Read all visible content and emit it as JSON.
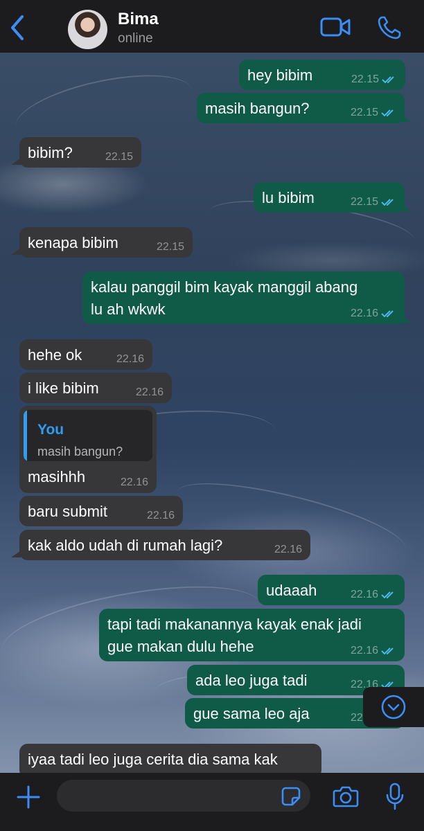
{
  "header": {
    "contact_name": "Bima",
    "status": "online"
  },
  "messages": [
    {
      "direction": "out",
      "text": "hey bibim",
      "time": "22.15",
      "read": true
    },
    {
      "direction": "out",
      "text": "masih bangun?",
      "time": "22.15",
      "read": true
    },
    {
      "direction": "in",
      "text": "bibim?",
      "time": "22.15"
    },
    {
      "direction": "out",
      "text": "lu bibim",
      "time": "22.15",
      "read": true
    },
    {
      "direction": "in",
      "text": "kenapa bibim",
      "time": "22.15"
    },
    {
      "direction": "out",
      "text_lines": [
        "kalau panggil bim kayak manggil abang",
        "lu ah wkwk"
      ],
      "time": "22.16",
      "read": true
    },
    {
      "direction": "in",
      "text": "hehe ok",
      "time": "22.16"
    },
    {
      "direction": "in",
      "text": "i like bibim",
      "time": "22.16"
    },
    {
      "direction": "in",
      "reply_to": {
        "author": "You",
        "text": "masih bangun?"
      },
      "text": "masihhh",
      "time": "22.16"
    },
    {
      "direction": "in",
      "text": "baru submit",
      "time": "22.16"
    },
    {
      "direction": "in",
      "text": "kak aldo udah di rumah lagi?",
      "time": "22.16"
    },
    {
      "direction": "out",
      "text": "udaaah",
      "time": "22.16",
      "read": true
    },
    {
      "direction": "out",
      "text_lines": [
        "tapi tadi makanannya kayak enak jadi",
        "gue makan dulu hehe"
      ],
      "time": "22.16",
      "read": true
    },
    {
      "direction": "out",
      "text": "ada leo juga tadi",
      "time": "22.16",
      "read": true
    },
    {
      "direction": "out",
      "text": "gue sama leo aja",
      "time": "22.16",
      "read": true
    },
    {
      "direction": "in",
      "text": "iyaa tadi leo juga cerita dia sama kak"
    }
  ],
  "input": {
    "placeholder": ""
  },
  "colors": {
    "accent": "#3a8ef6",
    "outgoing_bubble": "#0f5b48",
    "incoming_bubble": "#37373a",
    "read_check": "#4fb6ec"
  },
  "icons": [
    "back-chevron-icon",
    "video-camera-icon",
    "phone-icon",
    "chevron-down-icon",
    "plus-icon",
    "sticker-icon",
    "camera-icon",
    "microphone-icon"
  ]
}
